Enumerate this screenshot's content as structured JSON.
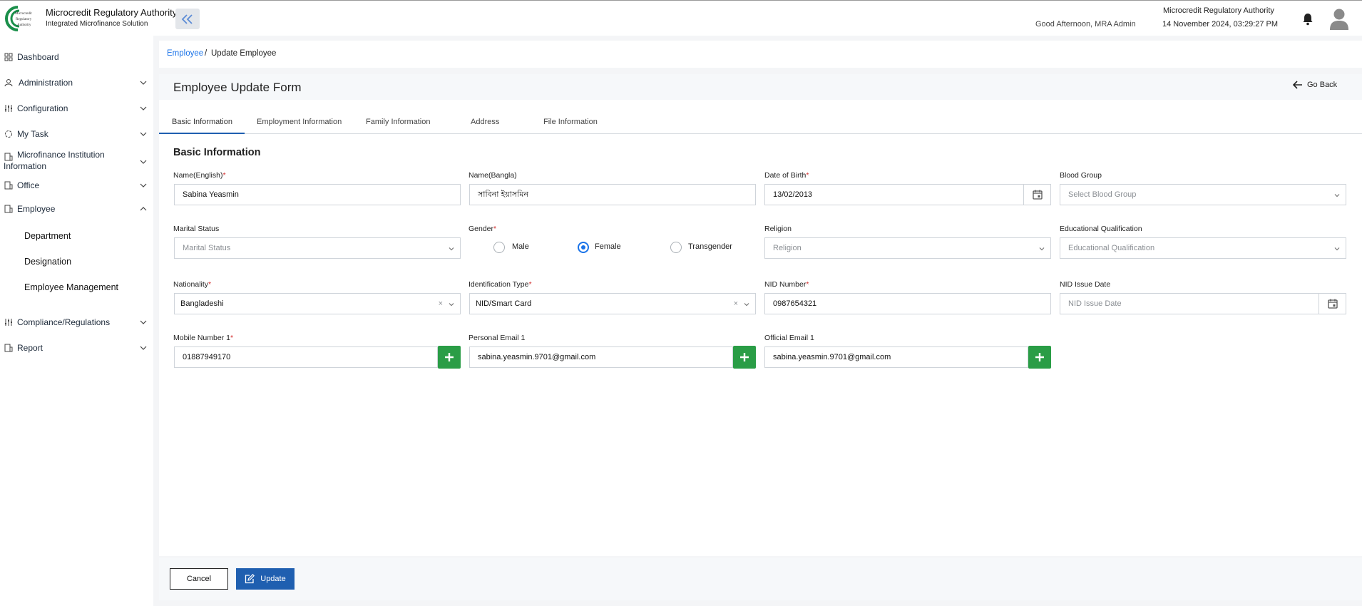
{
  "header": {
    "org_title": "Microcredit Regulatory Authority",
    "subtitle": "Integrated Microfinance Solution",
    "logo_text": "Microcredit Regulatory Authority",
    "greeting": "Good Afternoon, MRA Admin",
    "org_name_right": "Microcredit Regulatory Authority",
    "datetime": "14 November 2024, 03:29:27 PM"
  },
  "sidebar": {
    "items": [
      {
        "label": "Dashboard",
        "icon": "grid-icon"
      },
      {
        "label": "Administration",
        "icon": "admin-icon"
      },
      {
        "label": "Configuration",
        "icon": "sliders-icon"
      },
      {
        "label": "My Task",
        "icon": "task-icon"
      },
      {
        "label": "Microfinance Institution",
        "label2": "Information",
        "icon": "building-icon"
      },
      {
        "label": "Office",
        "icon": "office-icon"
      },
      {
        "label": "Employee",
        "icon": "employee-icon"
      },
      {
        "label": "Compliance/Regulations",
        "icon": "sliders-icon"
      },
      {
        "label": "Report",
        "icon": "report-icon"
      }
    ],
    "employee_sub": [
      "Department",
      "Designation",
      "Employee Management"
    ]
  },
  "breadcrumb": {
    "parent": "Employee",
    "sep": "/",
    "current": "Update Employee"
  },
  "form": {
    "title": "Employee Update Form",
    "go_back": "Go Back",
    "tabs": [
      "Basic Information",
      "Employment Information",
      "Family Information",
      "Address",
      "File Information"
    ],
    "section": "Basic Information",
    "fields": {
      "name_en": {
        "label": "Name(English)",
        "value": "Sabina Yeasmin"
      },
      "name_bn": {
        "label": "Name(Bangla)",
        "value": "সাবিনা ইয়াসমিন"
      },
      "dob": {
        "label": "Date of Birth",
        "value": "13/02/2013"
      },
      "blood": {
        "label": "Blood Group",
        "placeholder": "Select Blood Group"
      },
      "marital": {
        "label": "Marital Status",
        "placeholder": "Marital Status"
      },
      "gender": {
        "label": "Gender",
        "options": [
          "Male",
          "Female",
          "Transgender"
        ],
        "selected": "Female"
      },
      "religion": {
        "label": "Religion",
        "placeholder": "Religion"
      },
      "education": {
        "label": "Educational Qualification",
        "placeholder": "Educational Qualification"
      },
      "nationality": {
        "label": "Nationality",
        "value": "Bangladeshi"
      },
      "id_type": {
        "label": "Identification Type",
        "value": "NID/Smart Card"
      },
      "nid": {
        "label": "NID Number",
        "value": "0987654321"
      },
      "nid_issue": {
        "label": "NID Issue Date",
        "placeholder": "NID Issue Date"
      },
      "mobile": {
        "label": "Mobile Number 1",
        "value": "01887949170"
      },
      "personal_email": {
        "label": "Personal Email 1",
        "value": "sabina.yeasmin.9701@gmail.com"
      },
      "official_email": {
        "label": "Official Email 1",
        "value": "sabina.yeasmin.9701@gmail.com"
      }
    },
    "required_mark": "*"
  },
  "footer": {
    "cancel": "Cancel",
    "update": "Update"
  },
  "colors": {
    "primary": "#1f5fb0",
    "link": "#1a73e8",
    "success": "#2a9d46",
    "required": "#d32f2f"
  }
}
